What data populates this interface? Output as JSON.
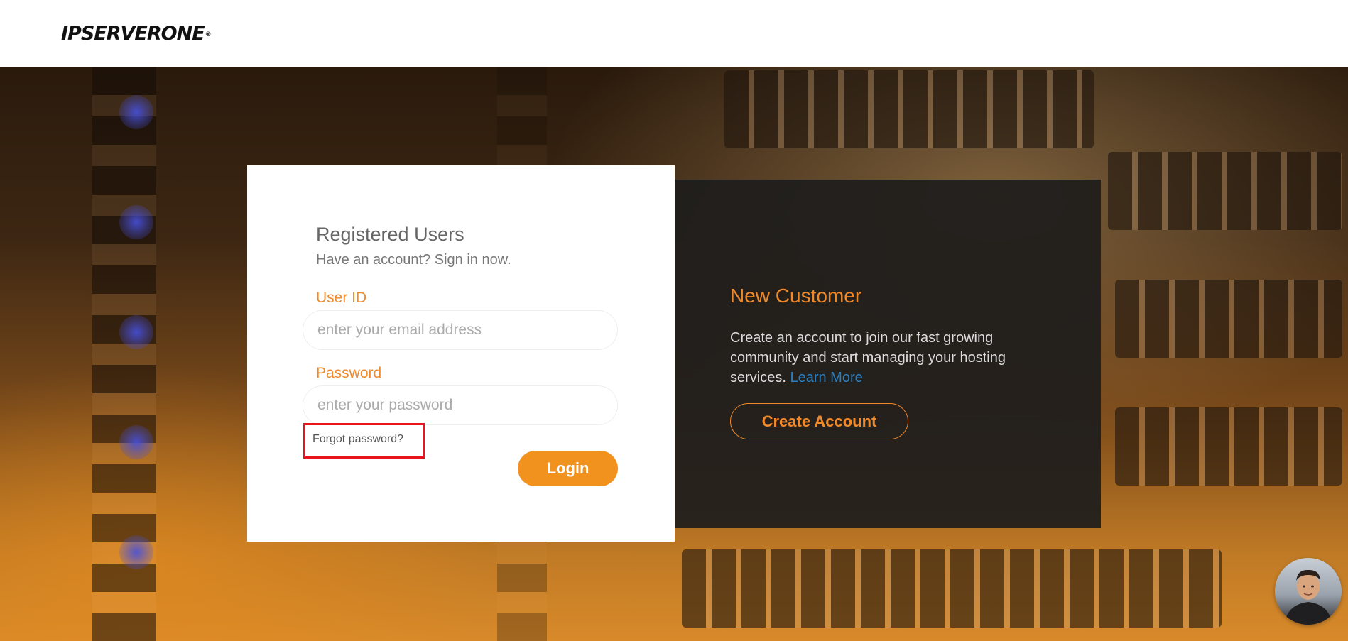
{
  "header": {
    "logo_text": "IPSERVERONE",
    "logo_mark": "®"
  },
  "login": {
    "title": "Registered Users",
    "subtitle": "Have an account? Sign in now.",
    "user_id_label": "User ID",
    "user_id_placeholder": "enter your email address",
    "user_id_value": "",
    "password_label": "Password",
    "password_placeholder": "enter your password",
    "password_value": "",
    "forgot_label": "Forgot password?",
    "login_label": "Login"
  },
  "new_customer": {
    "title": "New Customer",
    "description": "Create an account to join our fast growing community and start managing your hosting services. ",
    "learn_more_label": "Learn More",
    "create_label": "Create Account"
  },
  "chat": {
    "avatar_icon": "support-agent-avatar-icon"
  },
  "colors": {
    "accent": "#f0921d",
    "highlight_box": "#e8141c",
    "link": "#2b7fc1",
    "dark_panel": "#1e1d1c"
  }
}
